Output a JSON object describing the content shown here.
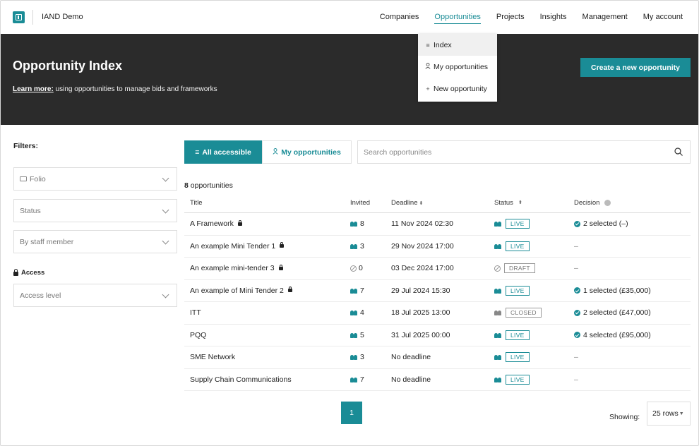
{
  "app": {
    "name": "IAND Demo"
  },
  "nav": {
    "items": [
      {
        "label": "Companies",
        "active": false
      },
      {
        "label": "Opportunities",
        "active": true
      },
      {
        "label": "Projects",
        "active": false
      },
      {
        "label": "Insights",
        "active": false
      },
      {
        "label": "Management",
        "active": false
      },
      {
        "label": "My account",
        "active": false
      }
    ]
  },
  "dropdown": {
    "items": [
      {
        "icon": "≡",
        "label": "Index",
        "selected": true
      },
      {
        "icon": "person-icon",
        "label": "My opportunities",
        "selected": false
      },
      {
        "icon": "+",
        "label": "New opportunity",
        "selected": false
      }
    ]
  },
  "hero": {
    "title": "Opportunity Index",
    "learn_more": "Learn more:",
    "subtitle": " using opportunities to manage bids and frameworks",
    "create_button": "Create a new opportunity"
  },
  "filters": {
    "title": "Filters:",
    "folio": "Folio",
    "status": "Status",
    "staff": "By staff member",
    "access_title": "Access",
    "access_level": "Access level"
  },
  "tabs": {
    "all": "All accessible",
    "my": "My opportunities"
  },
  "search": {
    "placeholder": "Search opportunities"
  },
  "count": {
    "number": "8",
    "label": " opportunities"
  },
  "table": {
    "headers": {
      "title": "Title",
      "invited": "Invited",
      "deadline": "Deadline",
      "status": "Status",
      "decision": "Decision"
    },
    "rows": [
      {
        "title": "A Framework",
        "locked": true,
        "invited": "8",
        "invited_icon": "people",
        "deadline": "11 Nov 2024 02:30",
        "status": "LIVE",
        "status_type": "live",
        "decision": "2 selected (–)",
        "decided": true
      },
      {
        "title": "An example Mini Tender 1",
        "locked": true,
        "invited": "3",
        "invited_icon": "people",
        "deadline": "29 Nov 2024 17:00",
        "status": "LIVE",
        "status_type": "live",
        "decision": "–",
        "decided": false
      },
      {
        "title": "An example mini-tender 3",
        "locked": true,
        "invited": "0",
        "invited_icon": "none",
        "deadline": "03 Dec 2024 17:00",
        "status": "DRAFT",
        "status_type": "draft",
        "decision": "–",
        "decided": false
      },
      {
        "title": "An example of Mini Tender 2",
        "locked": true,
        "invited": "7",
        "invited_icon": "people",
        "deadline": "29 Jul 2024 15:30",
        "status": "LIVE",
        "status_type": "live",
        "decision": "1 selected (£35,000)",
        "decided": true
      },
      {
        "title": "ITT",
        "locked": false,
        "invited": "4",
        "invited_icon": "people",
        "deadline": "18 Jul 2025 13:00",
        "status": "CLOSED",
        "status_type": "closed",
        "decision": "2 selected (£47,000)",
        "decided": true
      },
      {
        "title": "PQQ",
        "locked": false,
        "invited": "5",
        "invited_icon": "people",
        "deadline": "31 Jul 2025 00:00",
        "status": "LIVE",
        "status_type": "live",
        "decision": "4 selected (£95,000)",
        "decided": true
      },
      {
        "title": "SME Network",
        "locked": false,
        "invited": "3",
        "invited_icon": "people",
        "deadline": "No deadline",
        "status": "LIVE",
        "status_type": "live",
        "decision": "–",
        "decided": false
      },
      {
        "title": "Supply Chain Communications",
        "locked": false,
        "invited": "7",
        "invited_icon": "people",
        "deadline": "No deadline",
        "status": "LIVE",
        "status_type": "live",
        "decision": "–",
        "decided": false
      }
    ]
  },
  "pagination": {
    "page": "1",
    "showing_label": "Showing:",
    "rows_value": "25 rows"
  },
  "colors": {
    "accent": "#1a8c96",
    "hero_bg": "#2b2b2b"
  }
}
